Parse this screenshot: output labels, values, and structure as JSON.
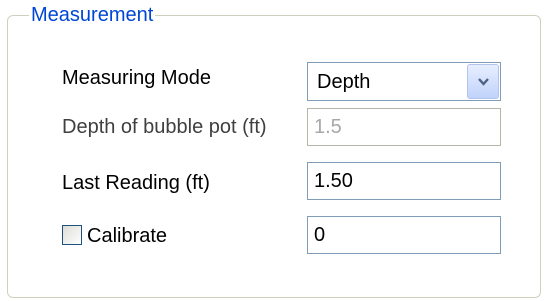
{
  "group": {
    "title": "Measurement"
  },
  "measuring_mode": {
    "label": "Measuring Mode",
    "selected": "Depth",
    "dropdown_icon": "chevron-down-icon"
  },
  "bubble_pot_depth": {
    "label": "Depth of bubble pot (ft)",
    "value": "1.5",
    "enabled": false
  },
  "last_reading": {
    "label": "Last Reading (ft)",
    "value": "1.50"
  },
  "calibrate": {
    "label": "Calibrate",
    "checked": false,
    "value": "0"
  },
  "colors": {
    "group_title": "#0046d5",
    "input_border": "#7f9db9",
    "disabled_text": "#a8a8a8"
  }
}
